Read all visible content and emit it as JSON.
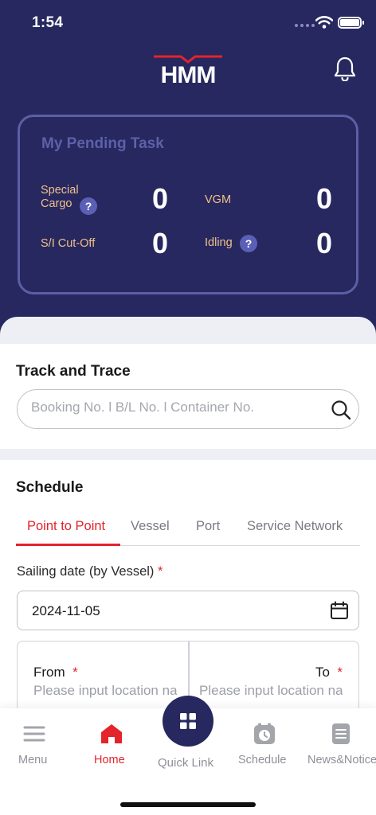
{
  "status_bar": {
    "time": "1:54"
  },
  "header": {
    "logo_text": "HMM",
    "notification_icon": "bell-icon"
  },
  "pending_task": {
    "title": "My Pending Task",
    "special_cargo": {
      "label": "Special Cargo",
      "value": "0"
    },
    "vgm": {
      "label": "VGM",
      "value": "0"
    },
    "si_cutoff": {
      "label": "S/I Cut-Off",
      "value": "0"
    },
    "idling": {
      "label": "Idling",
      "value": "0"
    },
    "help_glyph": "?"
  },
  "track_and_trace": {
    "title": "Track and Trace",
    "search_placeholder": "Booking No. l B/L No. l Container No."
  },
  "schedule": {
    "title": "Schedule",
    "tabs": [
      {
        "label": "Point to Point",
        "active": true
      },
      {
        "label": "Vessel"
      },
      {
        "label": "Port"
      },
      {
        "label": "Service Network"
      }
    ],
    "sailing_date_label": "Sailing date (by Vessel)",
    "required_mark": "*",
    "sailing_date_value": "2024-11-05",
    "from_label": "From",
    "to_label": "To",
    "location_placeholder": "Please input location name"
  },
  "bottom_nav": {
    "menu": "Menu",
    "home": "Home",
    "quick_link": "Quick Link",
    "schedule": "Schedule",
    "news": "News&Notice"
  },
  "colors": {
    "header_bg": "#26285f",
    "accent_red": "#e3242b",
    "pending_label": "#f2c08a",
    "card_border": "#5b5fa6"
  }
}
